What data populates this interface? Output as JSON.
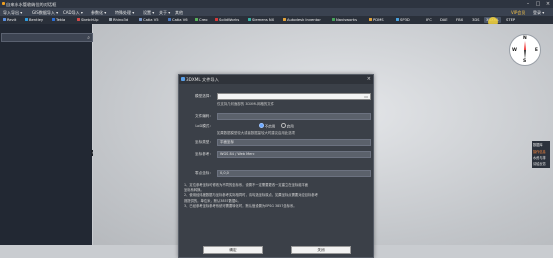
{
  "window": {
    "title": "自来水水管收纳位的对话框"
  },
  "menubar": {
    "items": [
      "导入导出 ▾",
      "GIS数据导入 ▾",
      "CAD导入 ▾",
      "参数化 ▾",
      "特殊处理 ▾",
      "设置 ▾",
      "关于 ▾",
      "其他"
    ],
    "vip_label": "VIP会员",
    "user_label": "登录 ▾"
  },
  "tabs": [
    {
      "label": "Revit",
      "color": "#5a8fe0"
    },
    {
      "label": "Bentley",
      "color": "#2f9de0"
    },
    {
      "label": "Tekla",
      "color": "#2c6fd6"
    },
    {
      "label": "SketchUp",
      "color": "#d24b4b"
    },
    {
      "label": "Rhino3d",
      "color": "#9aa3ad"
    },
    {
      "label": "Catia V5",
      "color": "#7b98c9"
    },
    {
      "label": "Catia V6",
      "color": "#4c7ac1"
    },
    {
      "label": "Creo",
      "color": "#59b35b"
    },
    {
      "label": "SolidWorks",
      "color": "#d93a3a"
    },
    {
      "label": "Siemens NX",
      "color": "#3ab3a6"
    },
    {
      "label": "Autodesk Inventor",
      "color": "#e3a33a"
    },
    {
      "label": "Navisworks",
      "color": "#46a35a"
    },
    {
      "label": "PDMS",
      "color": "#e0a23a"
    },
    {
      "label": "SP3D",
      "color": "#4aa3e0"
    },
    {
      "label": "IFC",
      "color": "#7c8590"
    },
    {
      "label": "DAE",
      "color": "#7c8590"
    },
    {
      "label": "FBX",
      "color": "#7c8590"
    },
    {
      "label": "3DS",
      "color": "#7c8590"
    },
    {
      "label": "3DXML",
      "color": "#7c8590"
    },
    {
      "label": "STEP",
      "color": "#7c8590"
    }
  ],
  "compass": {
    "n": "N",
    "s": "S",
    "w": "W",
    "e": "E"
  },
  "side_tools": [
    "数据库",
    "操作信息",
    "水资与排",
    "请给反馈"
  ],
  "dialog": {
    "title": "3DXML 文件导入",
    "model_path_label": "模型选择：",
    "model_path_hint": "仅支持几何面部的 3DXML网格的文件",
    "file_code_label": "文件编码：",
    "lod_label": "LoD模式：",
    "lod_options": [
      {
        "label": "不启用",
        "selected": true
      },
      {
        "label": "启用",
        "selected": false
      }
    ],
    "lod_hint": "如果数据模型较大或者数据量较大时建议启用此选项",
    "coord_type_label": "坐标类型：",
    "coord_type_value": "平面坐标",
    "coord_ref_label": "坐标参考：",
    "coord_ref_value": "WGS 84 / Web Merc",
    "zero_point_label": "零点坐标：",
    "zero_point_value": "0,0,0",
    "notes": [
      "1、定位参考坐标可修改为不同的坐标系，设置不一定需要更改一定建立在坐标组平面",
      "坐标系转换。",
      "2、使用经纬度数据与坐标参考实际相同时，请勾选坐标原点，如果坐标点需要对应目标参考",
      "则提供的，单位米，默认3857数据0。",
      "3、已经参考坐标参考系统可需要转化时，默认值设置为EPSG 3857坐标系。"
    ],
    "ok_label": "确定",
    "cancel_label": "关闭"
  }
}
